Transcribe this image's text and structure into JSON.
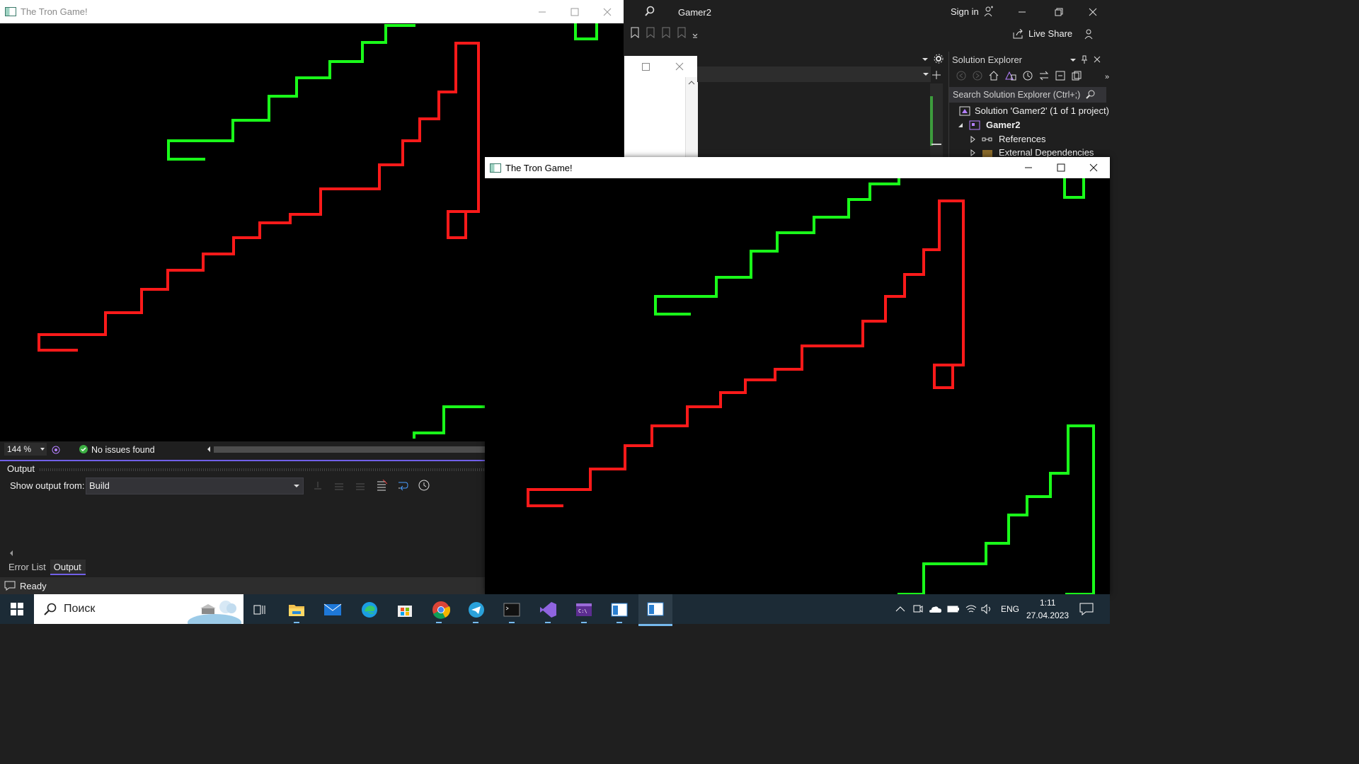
{
  "vs": {
    "project_title": "Gamer2",
    "sign_in": "Sign in",
    "live_share": "Live Share",
    "solution_explorer": {
      "title": "Solution Explorer",
      "search_placeholder": "Search Solution Explorer (Ctrl+;)",
      "solution_label": "Solution 'Gamer2' (1 of 1 project)",
      "project_label": "Gamer2",
      "references_label": "References",
      "external_deps_label": "External Dependencies"
    },
    "statusbar": {
      "zoom": "144 %",
      "issues": "No issues found",
      "ready": "Ready"
    },
    "output": {
      "title": "Output",
      "show_from_label": "Show output from:",
      "source_value": "Build",
      "tabs": [
        "Error List",
        "Output"
      ]
    }
  },
  "game_windows": [
    {
      "title": "The Tron Game!",
      "state": "inactive"
    },
    {
      "title": "The Tron Game!",
      "state": "active"
    }
  ],
  "game": {
    "colors": {
      "background": "#000000",
      "player1": "#ff1a1a",
      "player2": "#1aff1a"
    }
  },
  "taskbar": {
    "search_label": "Поиск",
    "lang": "ENG",
    "time": "1:11",
    "date": "27.04.2023",
    "apps": [
      "task-view-icon",
      "file-explorer-icon",
      "mail-icon",
      "edge-icon",
      "store-icon",
      "chrome-icon",
      "telegram-icon",
      "terminal-icon",
      "visual-studio-icon",
      "debug-console-icon",
      "tron-window-icon",
      "tron-window-icon-active"
    ]
  }
}
